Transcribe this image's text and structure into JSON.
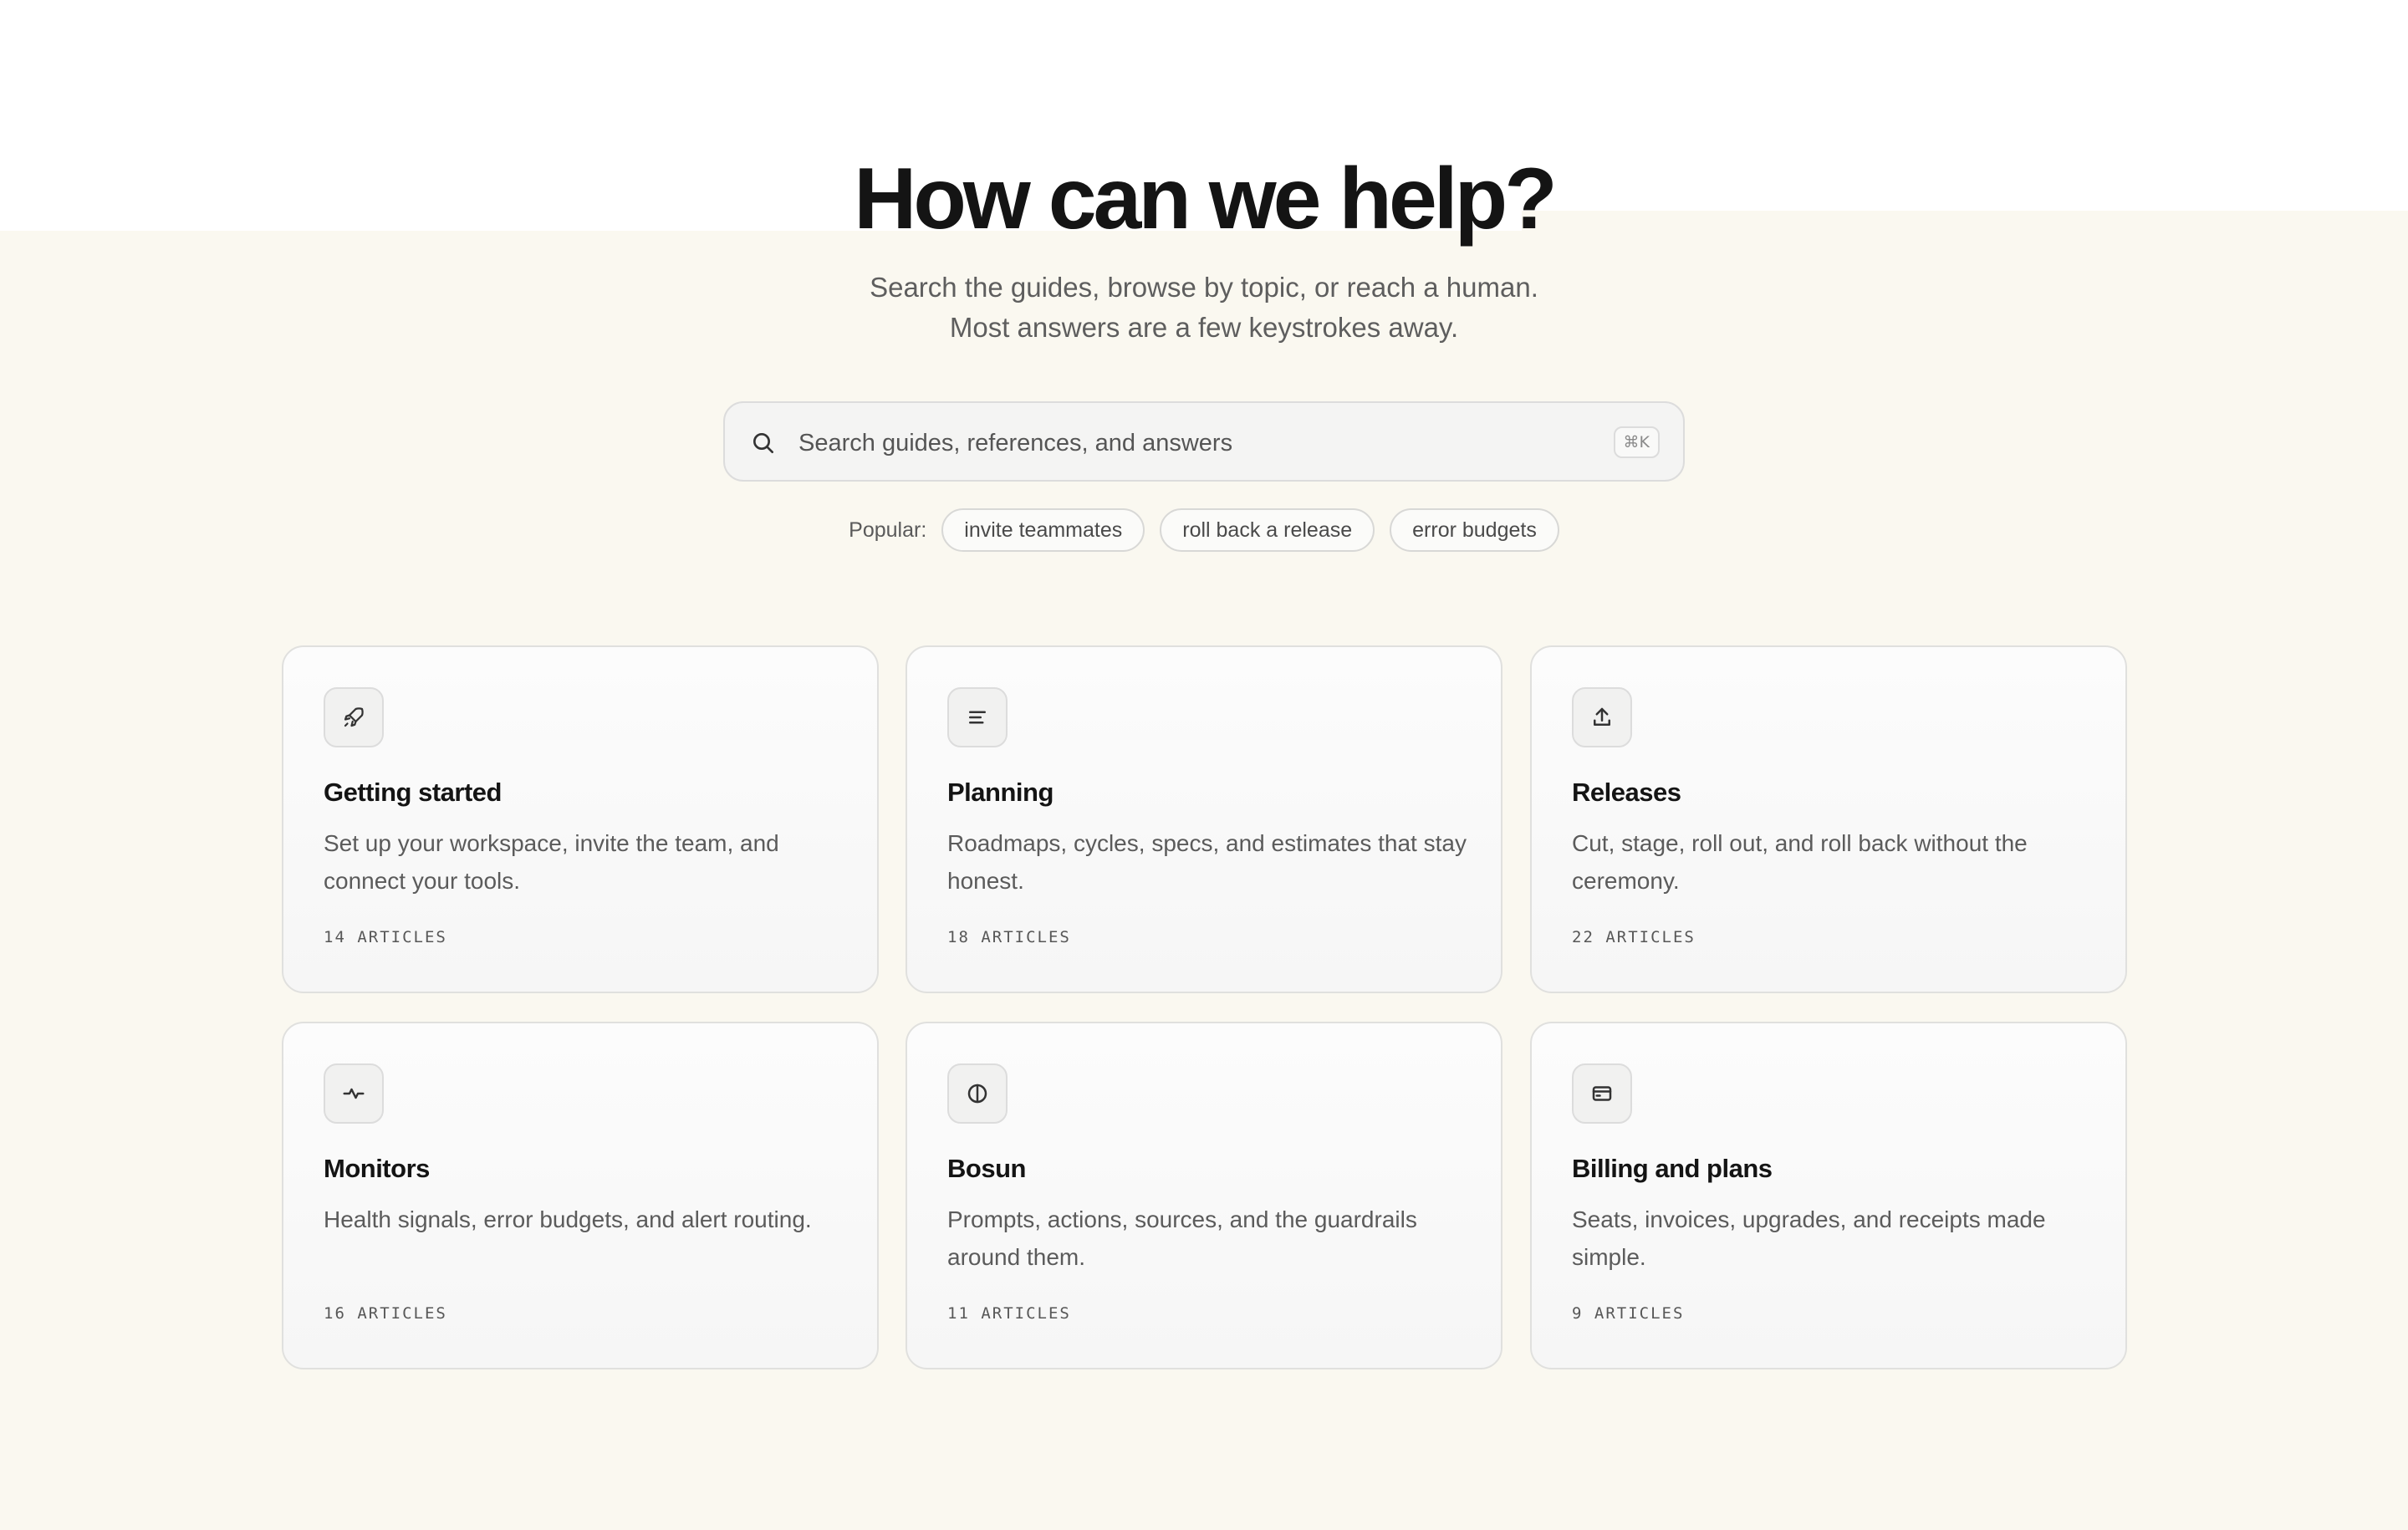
{
  "hero": {
    "title": "How can we help?",
    "subtitle": "Search the guides, browse by topic, or reach a human. Most answers are a few keystrokes away."
  },
  "search": {
    "placeholder": "Search guides, references, and answers",
    "shortcut": "⌘K"
  },
  "popular": {
    "label": "Popular:",
    "chips": [
      "invite teammates",
      "roll back a release",
      "error budgets"
    ]
  },
  "topics": [
    {
      "icon": "rocket-icon",
      "title": "Getting started",
      "description": "Set up your workspace, invite the team, and connect your tools.",
      "count": "14 ARTICLES"
    },
    {
      "icon": "text-lines-icon",
      "title": "Planning",
      "description": "Roadmaps, cycles, specs, and estimates that stay honest.",
      "count": "18 ARTICLES"
    },
    {
      "icon": "upload-icon",
      "title": "Releases",
      "description": "Cut, stage, roll out, and roll back without the ceremony.",
      "count": "22 ARTICLES"
    },
    {
      "icon": "pulse-icon",
      "title": "Monitors",
      "description": "Health signals, error budgets, and alert routing.",
      "count": "16 ARTICLES"
    },
    {
      "icon": "half-circle-icon",
      "title": "Bosun",
      "description": "Prompts, actions, sources, and the guardrails around them.",
      "count": "11 ARTICLES"
    },
    {
      "icon": "credit-card-icon",
      "title": "Billing and plans",
      "description": "Seats, invoices, upgrades, and receipts made simple.",
      "count": "9 ARTICLES"
    }
  ],
  "colors": {
    "background_cream": "#faf8f0",
    "text_primary": "#141414",
    "text_secondary": "#5b5b5b"
  }
}
